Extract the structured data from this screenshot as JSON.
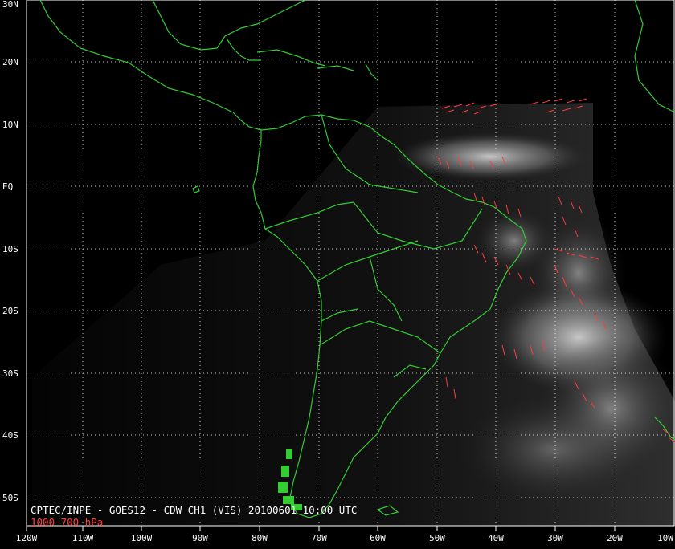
{
  "map": {
    "caption": "CPTEC/INPE - GOES12 - CDW CH1 (VIS) 20100601 10:00 UTC",
    "layer_label": "1000-700 hPa",
    "lat_labels": [
      "30N",
      "20N",
      "10N",
      "EQ",
      "10S",
      "20S",
      "30S",
      "40S",
      "50S"
    ],
    "lon_labels": [
      "120W",
      "110W",
      "100W",
      "90W",
      "80W",
      "70W",
      "60W",
      "50W",
      "40W",
      "30W",
      "20W",
      "10W"
    ],
    "colors": {
      "background": "#000000",
      "coastline": "#33cc33",
      "wind_vectors": "#ff3b3b",
      "grid": "#ffffff",
      "labels": "#ffffff"
    }
  }
}
